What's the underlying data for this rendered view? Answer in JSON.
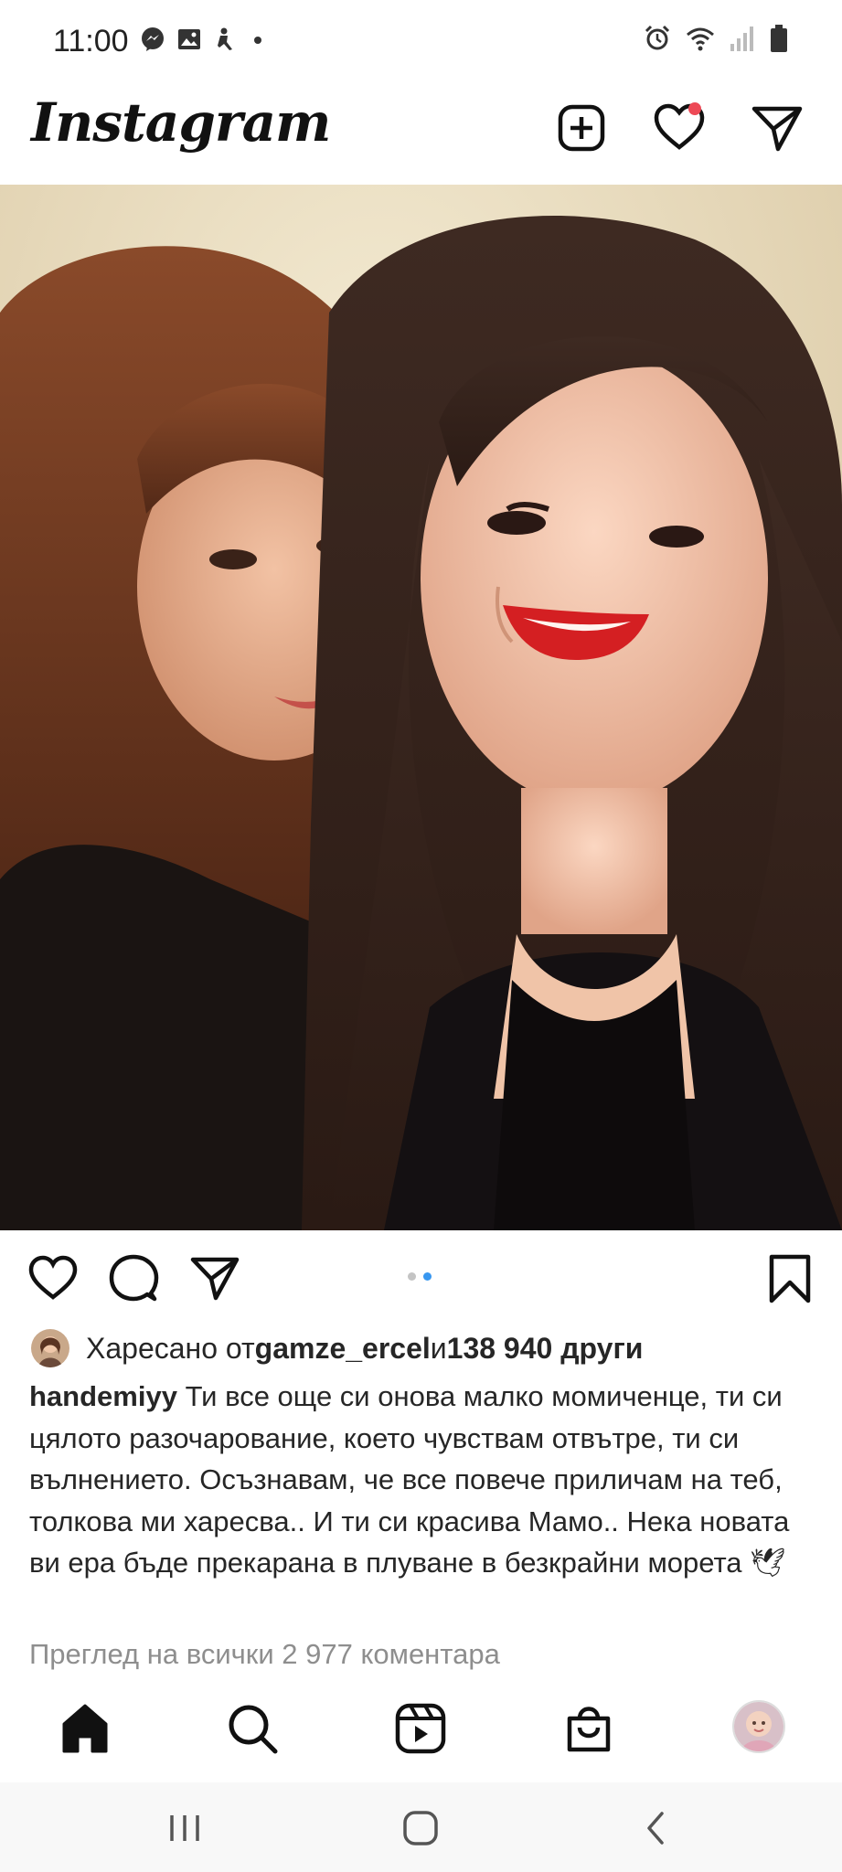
{
  "status_bar": {
    "time": "11:00",
    "left_icons": [
      "messenger-icon",
      "gallery-icon",
      "accessibility-icon",
      "dot-icon"
    ],
    "right_icons": [
      "alarm-icon",
      "wifi-icon",
      "signal-icon",
      "battery-icon"
    ]
  },
  "header": {
    "logo": "Instagram",
    "buttons": [
      "new-post-icon",
      "activity-heart-icon",
      "direct-message-icon"
    ],
    "notification_dot_color": "#ed4956"
  },
  "post": {
    "photo_description": "selfie of two women",
    "carousel": {
      "total": 2,
      "active": 2
    },
    "actions": [
      "like-icon",
      "comment-icon",
      "share-icon",
      "save-icon"
    ],
    "likes": {
      "prefix": "Харесано от ",
      "user": "gamze_ercel",
      "middle": " и ",
      "count": "138 940 други"
    },
    "caption": {
      "username": "handemiyy",
      "text": " Ти все още си онова малко момиченце, ти си цялото разочарование, което чувствам отвътре, ти си вълнението. Осъзнавам, че все повече приличам на теб, толкова ми харесва.. И ти си красива Мамо.. Нека новата ви ера бъде прекарана в плуване в безкрайни морета 🕊"
    },
    "view_comments": "Преглед на всички 2 977 коментара"
  },
  "bottom_nav": [
    "home-icon",
    "search-icon",
    "reels-icon",
    "shop-icon",
    "profile-avatar"
  ],
  "system_nav": [
    "recents-icon",
    "home-button-icon",
    "back-icon"
  ],
  "colors": {
    "accent": "#3897f0",
    "text": "#262626",
    "muted": "#8e8e8e",
    "notification": "#ed4956"
  }
}
